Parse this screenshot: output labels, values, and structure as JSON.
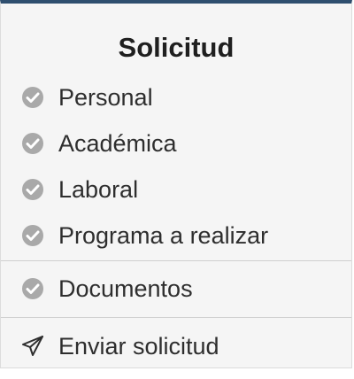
{
  "panel": {
    "title": "Solicitud",
    "accent_color": "#2f4f6f",
    "items": [
      {
        "label": "Personal",
        "icon": "check-circle-icon"
      },
      {
        "label": "Académica",
        "icon": "check-circle-icon"
      },
      {
        "label": "Laboral",
        "icon": "check-circle-icon"
      },
      {
        "label": "Programa a realizar",
        "icon": "check-circle-icon"
      }
    ],
    "documents": {
      "label": "Documentos",
      "icon": "check-circle-icon"
    },
    "submit": {
      "label": "Enviar solicitud",
      "icon": "paper-plane-icon"
    }
  }
}
